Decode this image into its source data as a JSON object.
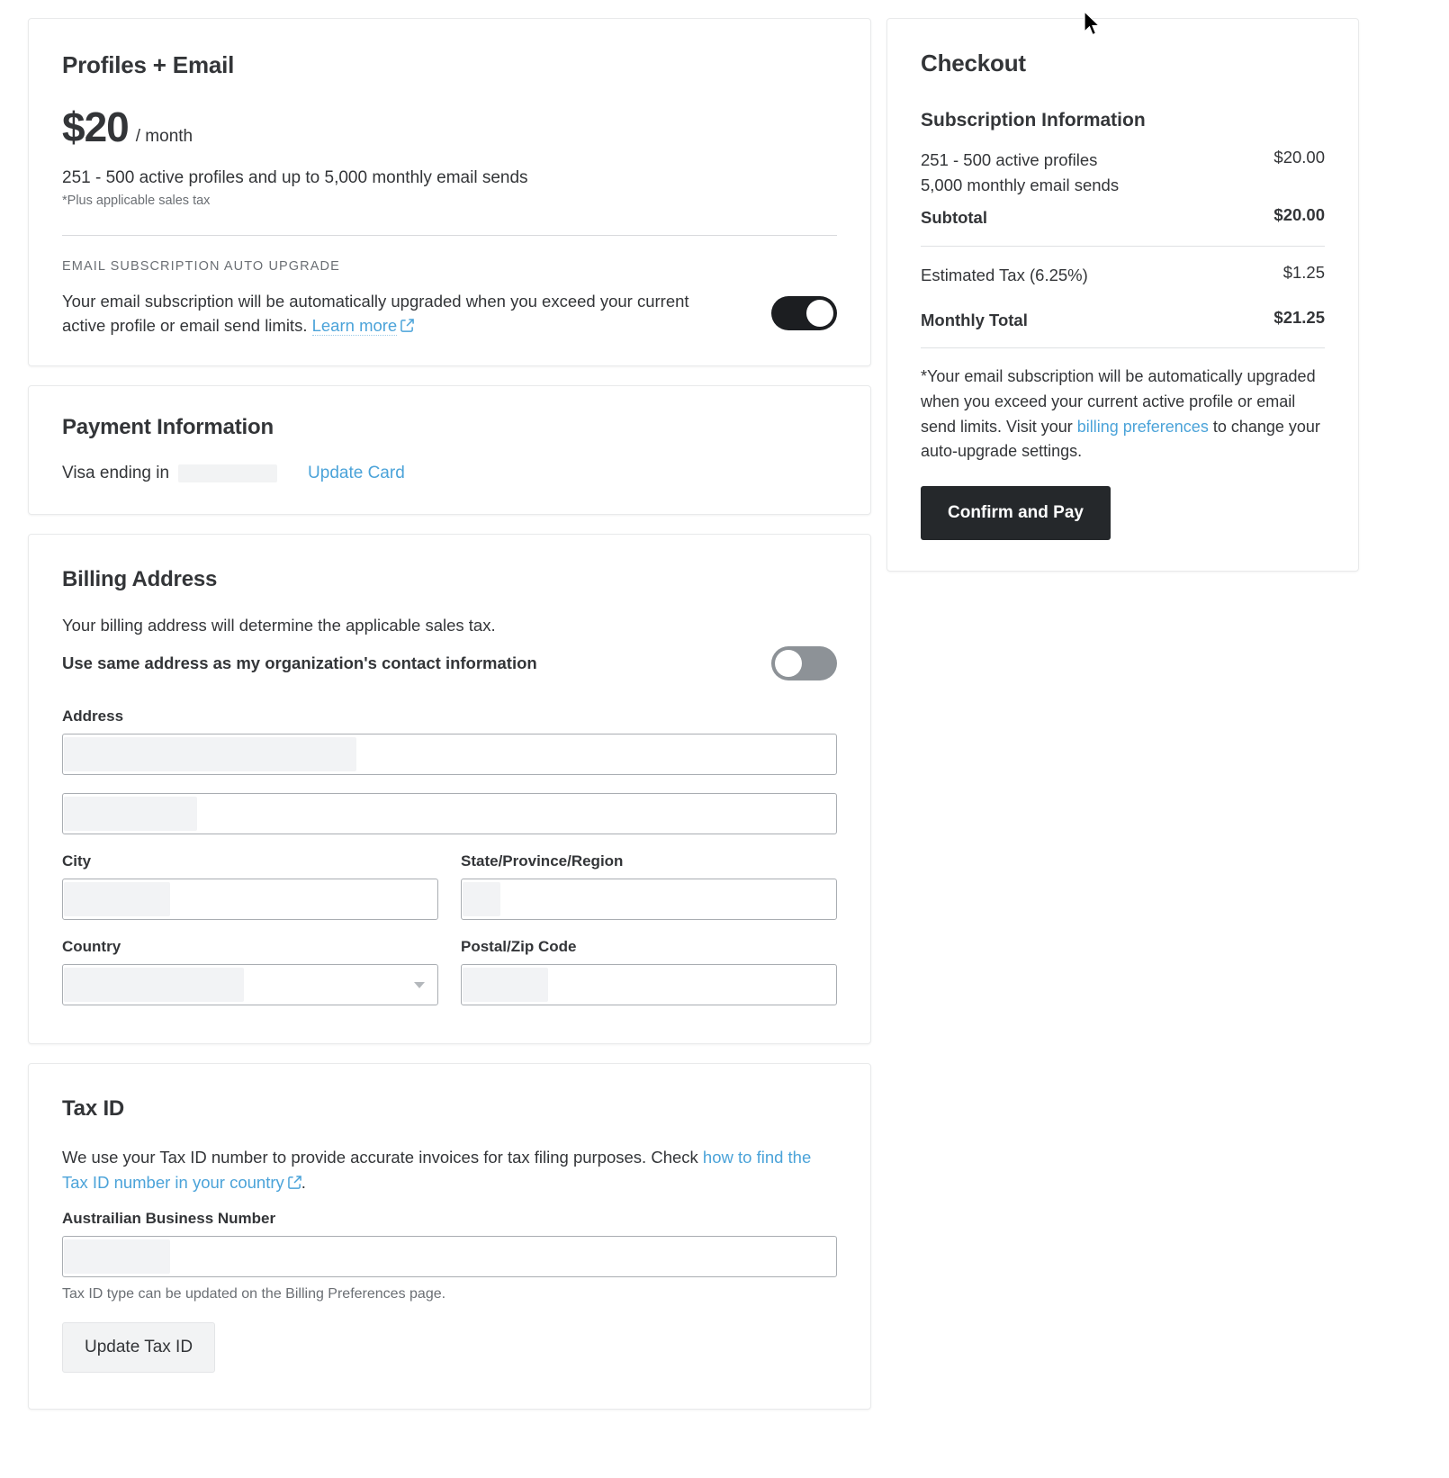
{
  "plan": {
    "title": "Profiles + Email",
    "price": "$20",
    "period": "/ month",
    "description": "251 - 500 active profiles and up to 5,000 monthly email sends",
    "tax_note": "*Plus applicable sales tax",
    "auto_upgrade_eyebrow": "EMAIL SUBSCRIPTION AUTO UPGRADE",
    "auto_upgrade_text": "Your email subscription will be automatically upgraded when you exceed your current active profile or email send limits.",
    "learn_more_label": "Learn more",
    "auto_upgrade_toggle_state": "on"
  },
  "payment": {
    "title": "Payment Information",
    "card_label": "Visa ending in",
    "card_number_redacted": "",
    "update_card_label": "Update Card"
  },
  "billing_address": {
    "title": "Billing Address",
    "description": "Your billing address will determine the applicable sales tax.",
    "same_address_label": "Use same address as my organization's contact information",
    "same_address_toggle_state": "off",
    "address_label": "Address",
    "address_line1_value": "",
    "address_line2_value": "",
    "city_label": "City",
    "city_value": "",
    "state_label": "State/Province/Region",
    "state_value": "",
    "country_label": "Country",
    "country_value": "",
    "postal_label": "Postal/Zip Code",
    "postal_value": ""
  },
  "tax_id": {
    "title": "Tax ID",
    "description_prefix": "We use your Tax ID number to provide accurate invoices for tax filing purposes. Check ",
    "help_link_label": "how to find the Tax ID number in your country",
    "description_suffix": ".",
    "field_label": "Austrailian Business Number",
    "field_value": "",
    "hint": "Tax ID type can be updated on the Billing Preferences page.",
    "update_button_label": "Update Tax ID"
  },
  "checkout": {
    "title": "Checkout",
    "subscription_heading": "Subscription Information",
    "lines": [
      {
        "label_line1": "251 - 500 active profiles",
        "label_line2": "5,000 monthly email sends",
        "value": "$20.00"
      },
      {
        "label_line1": "Subtotal",
        "label_line2": "",
        "value": "$20.00"
      },
      {
        "label_line1": "Estimated Tax (6.25%)",
        "label_line2": "",
        "value": "$1.25"
      },
      {
        "label_line1": "Monthly Total",
        "label_line2": "",
        "value": "$21.25"
      }
    ],
    "disclaimer_part1": "*Your email subscription will be automatically upgraded when you exceed your current active profile or email send limits. Visit your ",
    "disclaimer_link": "billing preferences",
    "disclaimer_part2": " to change your auto-upgrade settings.",
    "confirm_button_label": "Confirm and Pay"
  },
  "colors": {
    "link": "#4ba3d9",
    "primary_button": "#25282b",
    "toggle_on": "#1c1e21",
    "toggle_off": "#8d9297",
    "text": "#333538",
    "muted": "#6b6f74"
  },
  "icons": {
    "external_link": "external-link-icon",
    "chevron_down": "chevron-down-icon",
    "cursor": "mouse-cursor"
  }
}
